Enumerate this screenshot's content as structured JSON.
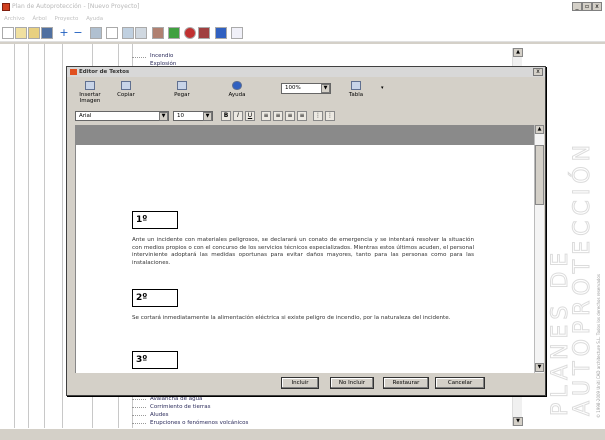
{
  "window": {
    "title": "Plan de Autoprotección - [Nuevo Proyecto]",
    "minimize": "_",
    "maximize": "▫",
    "close": "x"
  },
  "menu": [
    "Archivo",
    "Árbol",
    "Proyecto",
    "Ayuda"
  ],
  "tree": {
    "top_items": [
      "Incendio",
      "Explosión"
    ],
    "bottom_items": [
      "Avalancha de agua",
      "Corrimiento de tierras",
      "Aludes",
      "Erupciones o fenómenos volcánicos"
    ]
  },
  "brand": {
    "line1": "PLANES DE",
    "line2": "AUTOPROTECCIÓN",
    "copyright": "© 1998-2009 Uniti CAD architecture S.L. Todos los derechos reservados"
  },
  "editor": {
    "title": "Editor de Textos",
    "close": "x",
    "tools": {
      "insert_image": "Insertar Imagen",
      "copy": "Copiar",
      "paste": "Pegar",
      "help": "Ayuda",
      "table": "Tabla"
    },
    "zoom": "100%",
    "font": "Arial",
    "size": "10",
    "format": {
      "bold": "B",
      "italic": "I",
      "underline": "U"
    },
    "sections": [
      {
        "number": "1º",
        "text": "Ante un incidente con materiales peligrosos, se declarará un conato de emergencia y se intentará resolver la situación con medios propios o con el concurso de los servicios técnicos especializados. Mientras estos últimos acuden, el personal interviniente adoptará las medidas oportunas para evitar daños mayores, tanto para las personas como para las instalaciones."
      },
      {
        "number": "2º",
        "text": "Se cortará inmediatamente la alimentación eléctrica si existe peligro de incendio, por la naturaleza del incidente."
      },
      {
        "number": "3º",
        "text": ""
      }
    ],
    "buttons": {
      "include": "Incluir",
      "exclude": "No Incluir",
      "restore": "Restaurar",
      "cancel": "Cancelar"
    }
  },
  "colors": {
    "accent": "#0a246a",
    "dialog_bg": "#d4d0c8"
  }
}
